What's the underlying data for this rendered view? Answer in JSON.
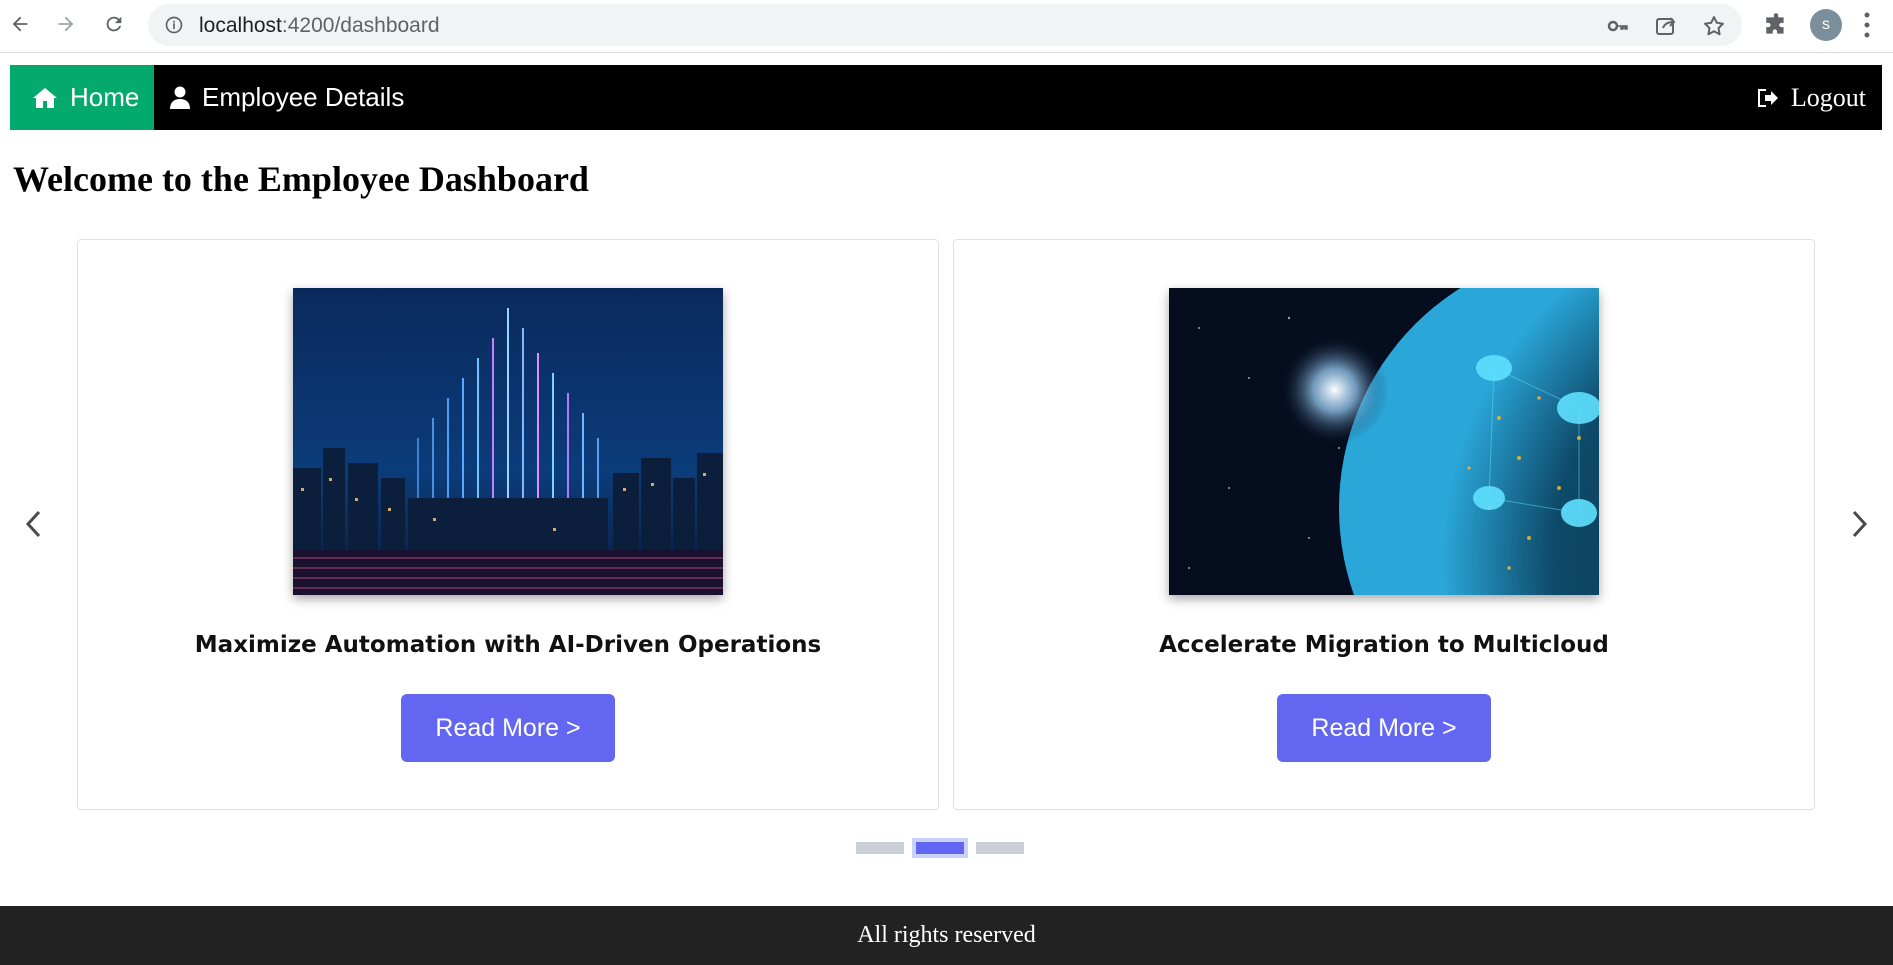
{
  "browser": {
    "url_host": "localhost",
    "url_path": ":4200/dashboard",
    "profile_initial": "s",
    "icons": [
      "back-icon",
      "forward-icon",
      "reload-icon",
      "info-icon",
      "key-icon",
      "share-icon",
      "star-icon",
      "extensions-icon",
      "menu-icon"
    ]
  },
  "nav": {
    "home_label": "Home",
    "employee_label": "Employee Details",
    "logout_label": "Logout",
    "home_color": "#04aa6d",
    "bar_color": "#000000"
  },
  "page": {
    "title": "Welcome to the Employee Dashboard"
  },
  "carousel": {
    "cards": [
      {
        "title": "Maximize Automation with AI-Driven Operations",
        "button_label": "Read More >"
      },
      {
        "title": "Accelerate Migration to Multicloud",
        "button_label": "Read More >"
      }
    ],
    "active_dot": 2,
    "dot_count": 3,
    "accent": "#6366f1"
  },
  "footer": {
    "text": "All rights reserved"
  }
}
